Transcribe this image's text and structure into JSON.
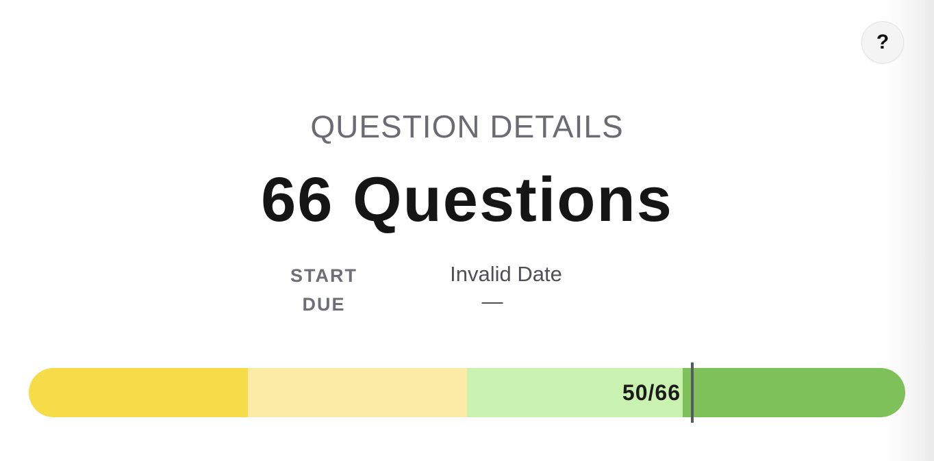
{
  "help": {
    "label": "?"
  },
  "header": {
    "eyebrow": "QUESTION DETAILS",
    "title": "66 Questions"
  },
  "dates": {
    "start_label": "START",
    "due_label": "DUE",
    "start_value": "Invalid Date",
    "due_value": "—"
  },
  "progress": {
    "label": "50/66",
    "answered": 50,
    "total": 66,
    "segments": [
      {
        "color": "#f7dc4a"
      },
      {
        "color": "#fbeba6"
      },
      {
        "color": "#c9f2b0"
      },
      {
        "color": "#7ec05a"
      }
    ],
    "marker_color": "#555a5e"
  }
}
